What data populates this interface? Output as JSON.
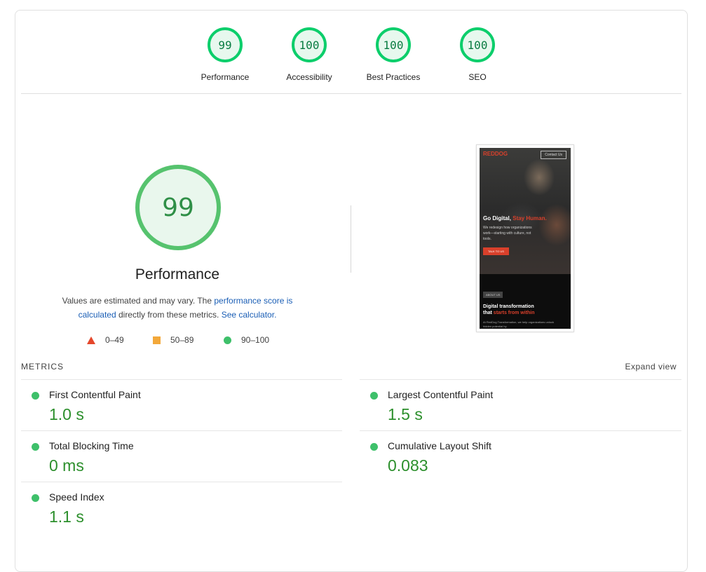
{
  "categories": [
    {
      "score": "99",
      "label": "Performance"
    },
    {
      "score": "100",
      "label": "Accessibility"
    },
    {
      "score": "100",
      "label": "Best Practices"
    },
    {
      "score": "100",
      "label": "SEO"
    }
  ],
  "main": {
    "score": "99",
    "title": "Performance",
    "desc_prefix": "Values are estimated and may vary. The ",
    "desc_link1": "performance score is calculated",
    "desc_middle": " directly from these metrics. ",
    "desc_link2": "See calculator.",
    "legend": [
      {
        "range": "0–49",
        "shape": "triangle",
        "color": "#e5472b"
      },
      {
        "range": "50–89",
        "shape": "square",
        "color": "#f3a83a"
      },
      {
        "range": "90–100",
        "shape": "circle",
        "color": "#3ec06a"
      }
    ]
  },
  "screenshot": {
    "logo": "REDDOG",
    "contact": "Contact Us",
    "headline_a": "Go Digital,",
    "headline_b": "Stay Human.",
    "sub": "We redesign how organizations work—starting with culture, not tools.",
    "cta": "TALK TO US",
    "about": "ABOUT US",
    "h2_a": "Digital transformation",
    "h2_b": "that",
    "h2_c": "starts from within",
    "p": "At RedDog Transformation, we help organizations unlock hidden potential by"
  },
  "metrics": {
    "heading": "METRICS",
    "expand": "Expand view",
    "items": [
      {
        "name": "First Contentful Paint",
        "value": "1.0 s"
      },
      {
        "name": "Largest Contentful Paint",
        "value": "1.5 s"
      },
      {
        "name": "Total Blocking Time",
        "value": "0 ms"
      },
      {
        "name": "Cumulative Layout Shift",
        "value": "0.083"
      },
      {
        "name": "Speed Index",
        "value": "1.1 s"
      }
    ]
  },
  "colors": {
    "pass": "#0cce6b",
    "average": "#ffa400",
    "fail": "#ff4e42"
  }
}
